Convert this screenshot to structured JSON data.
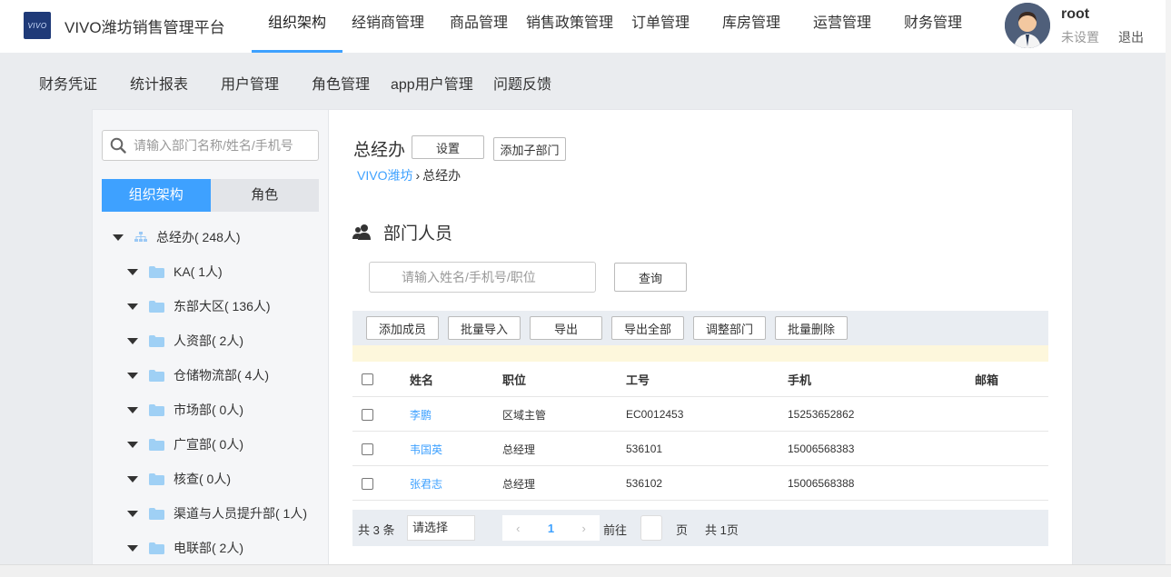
{
  "header": {
    "logo_text": "VIVO",
    "app_title": "VIVO潍坊销售管理平台",
    "nav": [
      {
        "label": "组织架构",
        "active": true
      },
      {
        "label": "经销商管理",
        "active": false
      },
      {
        "label": "商品管理",
        "active": false
      },
      {
        "label": "销售政策管理",
        "active": false
      },
      {
        "label": "订单管理",
        "active": false
      },
      {
        "label": "库房管理",
        "active": false
      },
      {
        "label": "运营管理",
        "active": false
      },
      {
        "label": "财务管理",
        "active": false
      }
    ],
    "user": {
      "name": "root",
      "sub": "未设置",
      "logout": "退出"
    }
  },
  "subnav": [
    "财务凭证",
    "统计报表",
    "用户管理",
    "角色管理",
    "app用户管理",
    "问题反馈"
  ],
  "sidebar": {
    "search_placeholder": "请输入部门名称/姓名/手机号",
    "tabs": [
      {
        "label": "组织架构",
        "active": true
      },
      {
        "label": "角色",
        "active": false
      }
    ],
    "tree": [
      {
        "label": "总经办( 248人)",
        "level": 0
      },
      {
        "label": "KA( 1人)",
        "level": 1
      },
      {
        "label": "东部大区( 136人)",
        "level": 1
      },
      {
        "label": "人资部( 2人)",
        "level": 1
      },
      {
        "label": "仓储物流部( 4人)",
        "level": 1
      },
      {
        "label": "市场部( 0人)",
        "level": 1
      },
      {
        "label": "广宣部( 0人)",
        "level": 1
      },
      {
        "label": "核查( 0人)",
        "level": 1
      },
      {
        "label": "渠道与人员提升部( 1人)",
        "level": 1
      },
      {
        "label": "电联部( 2人)",
        "level": 1
      }
    ]
  },
  "main": {
    "dept_title": "总经办",
    "settings_btn": "设置",
    "add_sub_btn": "添加子部门",
    "breadcrumb": {
      "root": "VIVO潍坊",
      "sep": "›",
      "current": "总经办"
    },
    "section_title": "部门人员",
    "member_search_placeholder": "请输入姓名/手机号/职位",
    "query_btn": "查询",
    "toolbar": [
      "添加成员",
      "批量导入",
      "导出",
      "导出全部",
      "调整部门",
      "批量删除"
    ],
    "columns": [
      "姓名",
      "职位",
      "工号",
      "手机",
      "邮箱"
    ],
    "rows": [
      {
        "name": "李鹏",
        "position": "区域主管",
        "id": "EC0012453",
        "phone": "15253652862",
        "email": ""
      },
      {
        "name": "韦国英",
        "position": "总经理",
        "id": "536101",
        "phone": "15006568383",
        "email": ""
      },
      {
        "name": "张君志",
        "position": "总经理",
        "id": "536102",
        "phone": "15006568388",
        "email": ""
      }
    ],
    "pager": {
      "total": "共 3 条",
      "page_size_placeholder": "请选择",
      "prev": "‹",
      "current": "1",
      "next": "›",
      "goto": "前往",
      "unit": "页",
      "count": "共 1页"
    }
  },
  "colors": {
    "accent": "#3ea1ff",
    "notice": "#fdf7dc",
    "toolbar": "#e9edf2"
  }
}
